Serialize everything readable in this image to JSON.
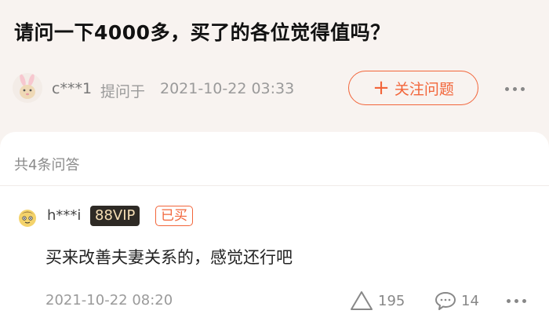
{
  "question": {
    "title": "请问一下4000多，买了的各位觉得值吗？"
  },
  "asker": {
    "name": "c***1",
    "asked_prefix": "提问于",
    "asked_time": "2021-10-22 03:33",
    "avatar_icon": "bunny-avatar-icon"
  },
  "follow_button": {
    "icon": "plus-icon",
    "label": "关注问题"
  },
  "answers_header": "共4条问答",
  "answer": {
    "username": "h***i",
    "vip_badge": "88VIP",
    "bought_badge": "已买",
    "text": "买来改善夫妻关系的，感觉还行吧",
    "time": "2021-10-22 08:20",
    "likes": "195",
    "comments": "14",
    "avatar_icon": "cartoon-avatar-icon"
  },
  "colors": {
    "accent": "#f2653a",
    "page_bg": "#f8f3f0",
    "vip_bg": "#2e2a25",
    "vip_text": "#f6dfb5"
  }
}
